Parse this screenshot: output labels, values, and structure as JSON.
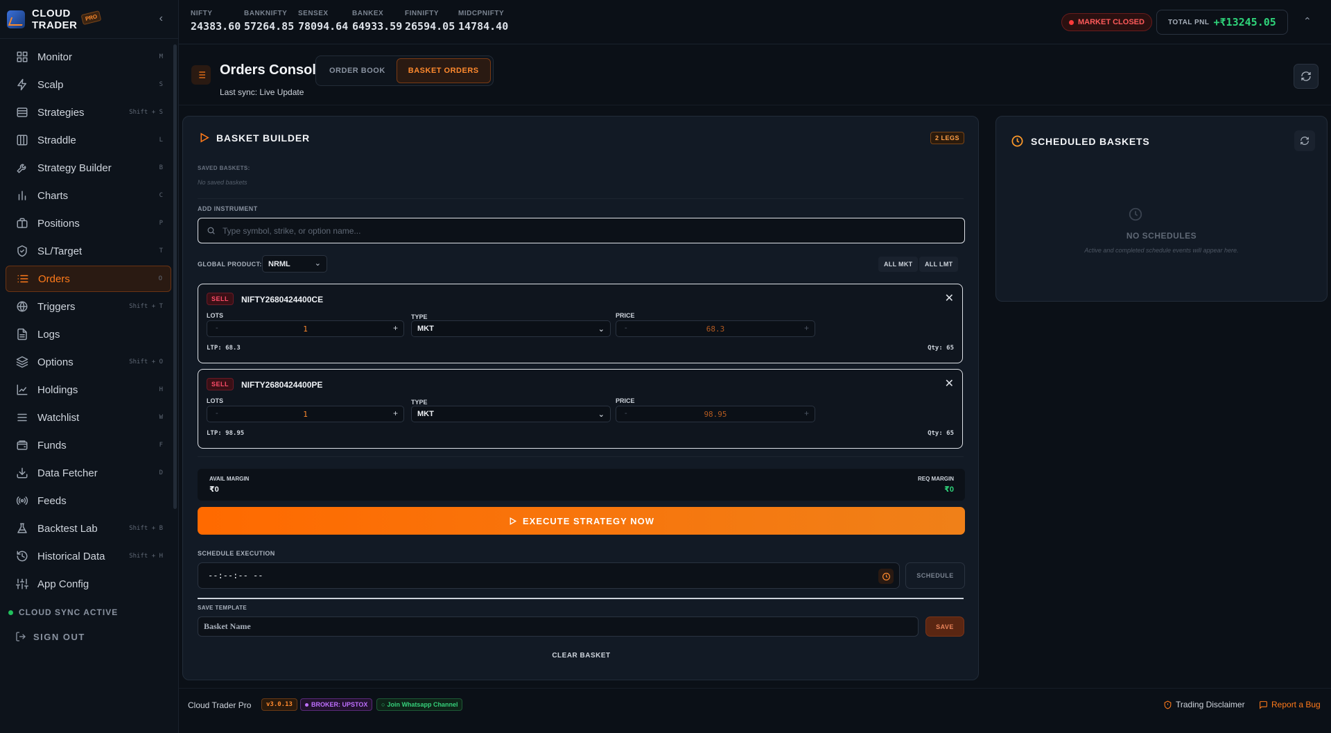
{
  "brand": {
    "name_line1": "CLOUD",
    "name_line2": "TRADER",
    "badge": "PRO"
  },
  "sidebar": {
    "items": [
      {
        "label": "Monitor",
        "key": "M",
        "icon": "grid-icon"
      },
      {
        "label": "Scalp",
        "key": "S",
        "icon": "bolt-icon"
      },
      {
        "label": "Strategies",
        "key": "Shift + S",
        "icon": "layers-icon"
      },
      {
        "label": "Straddle",
        "key": "L",
        "icon": "columns-icon"
      },
      {
        "label": "Strategy Builder",
        "key": "B",
        "icon": "wrench-icon"
      },
      {
        "label": "Charts",
        "key": "C",
        "icon": "bar-chart-icon"
      },
      {
        "label": "Positions",
        "key": "P",
        "icon": "briefcase-icon"
      },
      {
        "label": "SL/Target",
        "key": "T",
        "icon": "shield-icon"
      },
      {
        "label": "Orders",
        "key": "O",
        "icon": "list-icon"
      },
      {
        "label": "Triggers",
        "key": "Shift + T",
        "icon": "globe-icon"
      },
      {
        "label": "Logs",
        "key": "",
        "icon": "file-icon"
      },
      {
        "label": "Options",
        "key": "Shift + O",
        "icon": "stack-icon"
      },
      {
        "label": "Holdings",
        "key": "H",
        "icon": "line-chart-icon"
      },
      {
        "label": "Watchlist",
        "key": "W",
        "icon": "menu-icon"
      },
      {
        "label": "Funds",
        "key": "F",
        "icon": "wallet-icon"
      },
      {
        "label": "Data Fetcher",
        "key": "D",
        "icon": "download-icon"
      },
      {
        "label": "Feeds",
        "key": "",
        "icon": "broadcast-icon"
      },
      {
        "label": "Backtest Lab",
        "key": "Shift + B",
        "icon": "flask-icon"
      },
      {
        "label": "Historical Data",
        "key": "Shift + H",
        "icon": "history-icon"
      },
      {
        "label": "App Config",
        "key": "",
        "icon": "sliders-icon"
      }
    ],
    "active_index": 8,
    "sync_status": "CLOUD SYNC ACTIVE",
    "sign_out": "SIGN OUT"
  },
  "tickers": [
    {
      "name": "NIFTY",
      "value": "24383.60"
    },
    {
      "name": "BANKNIFTY",
      "value": "57264.85"
    },
    {
      "name": "SENSEX",
      "value": "78094.64"
    },
    {
      "name": "BANKEX",
      "value": "64933.59"
    },
    {
      "name": "FINNIFTY",
      "value": "26594.05"
    },
    {
      "name": "MIDCPNIFTY",
      "value": "14784.40"
    }
  ],
  "market_status": "MARKET CLOSED",
  "pnl": {
    "label": "TOTAL PNL",
    "value": "+₹13245.05"
  },
  "page": {
    "title": "Orders Console",
    "last_sync": "Last sync: Live Update",
    "tabs": [
      "ORDER BOOK",
      "BASKET ORDERS"
    ],
    "active_tab": 1
  },
  "builder": {
    "title": "BASKET BUILDER",
    "legs_badge": "2 LEGS",
    "saved_label": "SAVED BASKETS:",
    "saved_empty": "No saved baskets",
    "add_label": "ADD INSTRUMENT",
    "search_placeholder": "Type symbol, strike, or option name...",
    "global_product_label": "GLOBAL PRODUCT:",
    "global_product": "NRML",
    "all_mkt": "ALL MKT",
    "all_lmt": "ALL LMT",
    "lots_label": "LOTS",
    "type_label": "TYPE",
    "price_label": "PRICE",
    "legs": [
      {
        "side": "SELL",
        "symbol": "NIFTY2680424400CE",
        "lots": "1",
        "type": "MKT",
        "price": "68.3",
        "ltp": "LTP: 68.3",
        "qty": "Qty: 65"
      },
      {
        "side": "SELL",
        "symbol": "NIFTY2680424400PE",
        "lots": "1",
        "type": "MKT",
        "price": "98.95",
        "ltp": "LTP: 98.95",
        "qty": "Qty: 65"
      }
    ],
    "avail_margin_label": "AVAIL MARGIN",
    "avail_margin": "₹0",
    "req_margin_label": "REQ MARGIN",
    "req_margin": "₹0",
    "execute": "EXECUTE STRATEGY NOW",
    "schedule_label": "SCHEDULE EXECUTION",
    "schedule_time": "--:--:-- --",
    "schedule_btn": "SCHEDULE",
    "template_label": "SAVE TEMPLATE",
    "template_placeholder": "Basket Name",
    "save_btn": "SAVE",
    "clear_btn": "CLEAR BASKET"
  },
  "scheduled": {
    "title": "SCHEDULED BASKETS",
    "empty_title": "NO SCHEDULES",
    "empty_sub": "Active and completed schedule events will appear here."
  },
  "footer": {
    "app": "Cloud Trader Pro",
    "version": "v3.0.13",
    "broker": "BROKER: UPSTOX",
    "whatsapp": "Join Whatsapp Channel",
    "disclaimer": "Trading Disclaimer",
    "bug": "Report a Bug"
  },
  "colors": {
    "accent": "#ff7a1a",
    "profit": "#2fd37a",
    "danger": "#ff3b3b"
  }
}
